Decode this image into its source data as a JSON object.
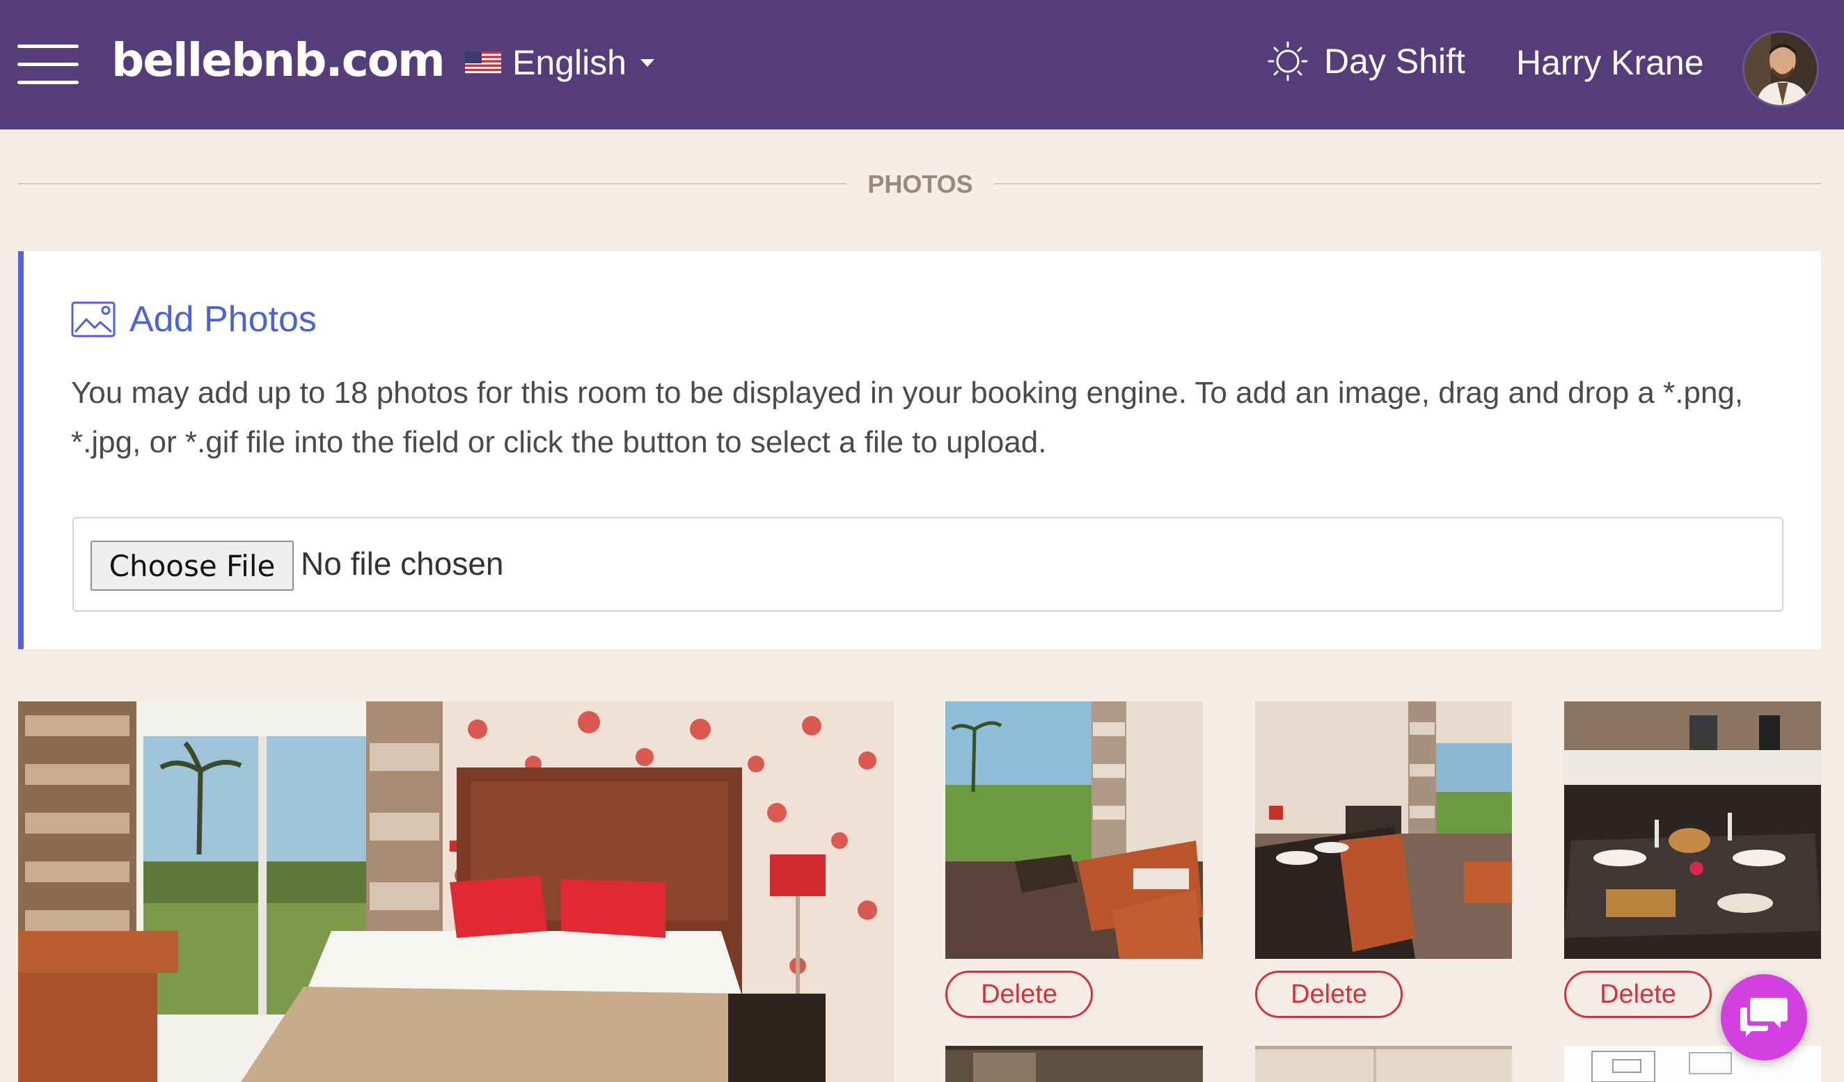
{
  "header": {
    "brand": "bellebnb.com",
    "language": "English",
    "shift": "Day Shift",
    "user_name": "Harry Krane"
  },
  "section": {
    "title": "PHOTOS"
  },
  "add_photos": {
    "title": "Add Photos",
    "description": "You may add up to 18 photos for this room to be displayed in your booking engine. To add an image, drag and drop a *.png, *.jpg, or *.gif file into the field or click the button to select a file to upload.",
    "choose_file_label": "Choose File",
    "file_status": "No file chosen"
  },
  "gallery": {
    "delete_label": "Delete",
    "photos": [
      "bedroom-main",
      "living-room",
      "dining-room",
      "kitchen-table"
    ]
  },
  "colors": {
    "header_bg": "#553c7b",
    "page_bg": "#f6ede7",
    "accent": "#4b62d8",
    "delete": "#d92e3d",
    "chat": "#d33fe0"
  }
}
